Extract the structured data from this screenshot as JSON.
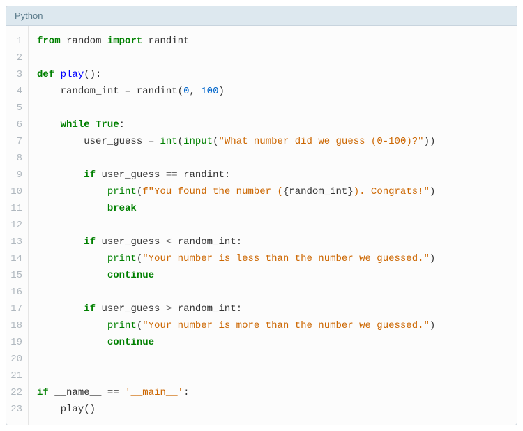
{
  "header": {
    "language": "Python"
  },
  "code": {
    "lines": [
      {
        "n": 1,
        "tokens": [
          {
            "cls": "tok-keyword",
            "t": "from"
          },
          {
            "cls": "",
            "t": " "
          },
          {
            "cls": "tok-name",
            "t": "random"
          },
          {
            "cls": "",
            "t": " "
          },
          {
            "cls": "tok-keyword",
            "t": "import"
          },
          {
            "cls": "",
            "t": " "
          },
          {
            "cls": "tok-name",
            "t": "randint"
          }
        ]
      },
      {
        "n": 2,
        "tokens": []
      },
      {
        "n": 3,
        "tokens": [
          {
            "cls": "tok-keyword",
            "t": "def"
          },
          {
            "cls": "",
            "t": " "
          },
          {
            "cls": "tok-funcname",
            "t": "play"
          },
          {
            "cls": "tok-paren",
            "t": "():"
          }
        ]
      },
      {
        "n": 4,
        "tokens": [
          {
            "cls": "",
            "t": "    "
          },
          {
            "cls": "tok-name",
            "t": "random_int"
          },
          {
            "cls": "",
            "t": " "
          },
          {
            "cls": "tok-op",
            "t": "="
          },
          {
            "cls": "",
            "t": " "
          },
          {
            "cls": "tok-name",
            "t": "randint"
          },
          {
            "cls": "tok-paren",
            "t": "("
          },
          {
            "cls": "tok-number",
            "t": "0"
          },
          {
            "cls": "tok-paren",
            "t": ", "
          },
          {
            "cls": "tok-number",
            "t": "100"
          },
          {
            "cls": "tok-paren",
            "t": ")"
          }
        ]
      },
      {
        "n": 5,
        "tokens": []
      },
      {
        "n": 6,
        "tokens": [
          {
            "cls": "",
            "t": "    "
          },
          {
            "cls": "tok-keyword",
            "t": "while"
          },
          {
            "cls": "",
            "t": " "
          },
          {
            "cls": "tok-keyword",
            "t": "True"
          },
          {
            "cls": "tok-paren",
            "t": ":"
          }
        ]
      },
      {
        "n": 7,
        "tokens": [
          {
            "cls": "",
            "t": "        "
          },
          {
            "cls": "tok-name",
            "t": "user_guess"
          },
          {
            "cls": "",
            "t": " "
          },
          {
            "cls": "tok-op",
            "t": "="
          },
          {
            "cls": "",
            "t": " "
          },
          {
            "cls": "tok-builtin",
            "t": "int"
          },
          {
            "cls": "tok-paren",
            "t": "("
          },
          {
            "cls": "tok-builtin",
            "t": "input"
          },
          {
            "cls": "tok-paren",
            "t": "("
          },
          {
            "cls": "tok-string",
            "t": "\"What number did we guess (0-100)?\""
          },
          {
            "cls": "tok-paren",
            "t": "))"
          }
        ]
      },
      {
        "n": 8,
        "tokens": []
      },
      {
        "n": 9,
        "tokens": [
          {
            "cls": "",
            "t": "        "
          },
          {
            "cls": "tok-keyword",
            "t": "if"
          },
          {
            "cls": "",
            "t": " "
          },
          {
            "cls": "tok-name",
            "t": "user_guess"
          },
          {
            "cls": "",
            "t": " "
          },
          {
            "cls": "tok-op",
            "t": "=="
          },
          {
            "cls": "",
            "t": " "
          },
          {
            "cls": "tok-name",
            "t": "randint"
          },
          {
            "cls": "tok-paren",
            "t": ":"
          }
        ]
      },
      {
        "n": 10,
        "tokens": [
          {
            "cls": "",
            "t": "            "
          },
          {
            "cls": "tok-builtin",
            "t": "print"
          },
          {
            "cls": "tok-paren",
            "t": "("
          },
          {
            "cls": "tok-fstring",
            "t": "f\"You found the number ("
          },
          {
            "cls": "tok-fstringbrace",
            "t": "{"
          },
          {
            "cls": "tok-name",
            "t": "random_int"
          },
          {
            "cls": "tok-fstringbrace",
            "t": "}"
          },
          {
            "cls": "tok-fstring",
            "t": "). Congrats!\""
          },
          {
            "cls": "tok-paren",
            "t": ")"
          }
        ]
      },
      {
        "n": 11,
        "tokens": [
          {
            "cls": "",
            "t": "            "
          },
          {
            "cls": "tok-keyword",
            "t": "break"
          }
        ]
      },
      {
        "n": 12,
        "tokens": []
      },
      {
        "n": 13,
        "tokens": [
          {
            "cls": "",
            "t": "        "
          },
          {
            "cls": "tok-keyword",
            "t": "if"
          },
          {
            "cls": "",
            "t": " "
          },
          {
            "cls": "tok-name",
            "t": "user_guess"
          },
          {
            "cls": "",
            "t": " "
          },
          {
            "cls": "tok-op",
            "t": "<"
          },
          {
            "cls": "",
            "t": " "
          },
          {
            "cls": "tok-name",
            "t": "random_int"
          },
          {
            "cls": "tok-paren",
            "t": ":"
          }
        ]
      },
      {
        "n": 14,
        "tokens": [
          {
            "cls": "",
            "t": "            "
          },
          {
            "cls": "tok-builtin",
            "t": "print"
          },
          {
            "cls": "tok-paren",
            "t": "("
          },
          {
            "cls": "tok-string",
            "t": "\"Your number is less than the number we guessed.\""
          },
          {
            "cls": "tok-paren",
            "t": ")"
          }
        ]
      },
      {
        "n": 15,
        "tokens": [
          {
            "cls": "",
            "t": "            "
          },
          {
            "cls": "tok-keyword",
            "t": "continue"
          }
        ]
      },
      {
        "n": 16,
        "tokens": []
      },
      {
        "n": 17,
        "tokens": [
          {
            "cls": "",
            "t": "        "
          },
          {
            "cls": "tok-keyword",
            "t": "if"
          },
          {
            "cls": "",
            "t": " "
          },
          {
            "cls": "tok-name",
            "t": "user_guess"
          },
          {
            "cls": "",
            "t": " "
          },
          {
            "cls": "tok-op",
            "t": ">"
          },
          {
            "cls": "",
            "t": " "
          },
          {
            "cls": "tok-name",
            "t": "random_int"
          },
          {
            "cls": "tok-paren",
            "t": ":"
          }
        ]
      },
      {
        "n": 18,
        "tokens": [
          {
            "cls": "",
            "t": "            "
          },
          {
            "cls": "tok-builtin",
            "t": "print"
          },
          {
            "cls": "tok-paren",
            "t": "("
          },
          {
            "cls": "tok-string",
            "t": "\"Your number is more than the number we guessed.\""
          },
          {
            "cls": "tok-paren",
            "t": ")"
          }
        ]
      },
      {
        "n": 19,
        "tokens": [
          {
            "cls": "",
            "t": "            "
          },
          {
            "cls": "tok-keyword",
            "t": "continue"
          }
        ]
      },
      {
        "n": 20,
        "tokens": []
      },
      {
        "n": 21,
        "tokens": []
      },
      {
        "n": 22,
        "tokens": [
          {
            "cls": "tok-keyword",
            "t": "if"
          },
          {
            "cls": "",
            "t": " "
          },
          {
            "cls": "tok-name",
            "t": "__name__"
          },
          {
            "cls": "",
            "t": " "
          },
          {
            "cls": "tok-op",
            "t": "=="
          },
          {
            "cls": "",
            "t": " "
          },
          {
            "cls": "tok-string",
            "t": "'__main__'"
          },
          {
            "cls": "tok-paren",
            "t": ":"
          }
        ]
      },
      {
        "n": 23,
        "tokens": [
          {
            "cls": "",
            "t": "    "
          },
          {
            "cls": "tok-name",
            "t": "play"
          },
          {
            "cls": "tok-paren",
            "t": "()"
          }
        ]
      }
    ]
  }
}
